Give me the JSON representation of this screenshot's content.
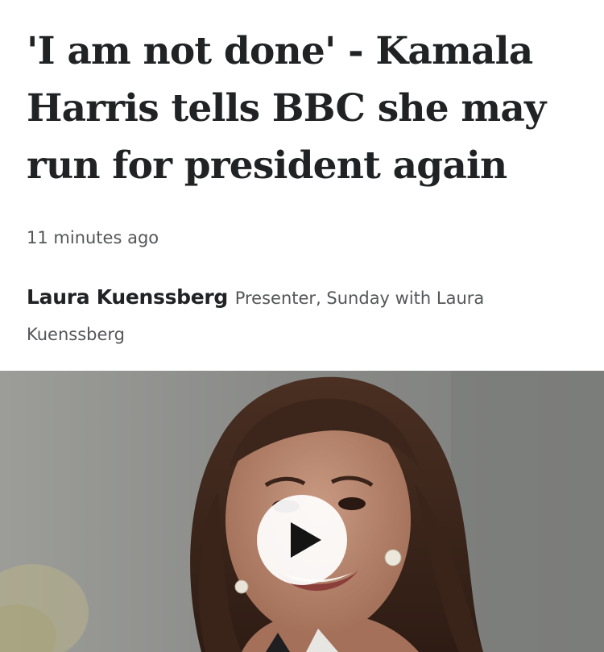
{
  "article": {
    "headline": "'I am not done' - Kamala Harris tells BBC she may run for president again",
    "timestamp": "11 minutes ago",
    "author_name": "Laura Kuenssberg",
    "author_role": "Presenter, Sunday with Laura Kuenssberg"
  },
  "media": {
    "type": "video",
    "icons": {
      "play": "play-icon"
    }
  }
}
